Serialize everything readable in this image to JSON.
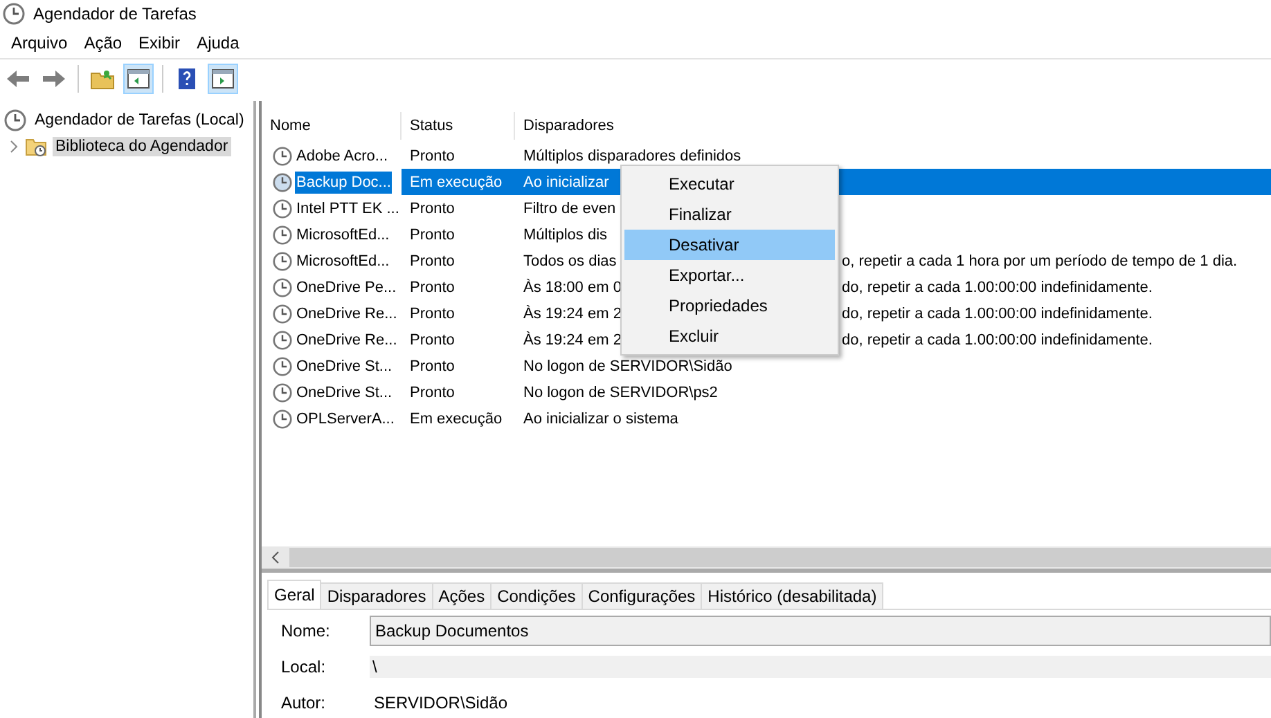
{
  "window": {
    "title": "Agendador de Tarefas"
  },
  "menu_bar": [
    "Arquivo",
    "Ação",
    "Exibir",
    "Ajuda"
  ],
  "toolbar": [
    {
      "kind": "back",
      "pressed": false
    },
    {
      "kind": "forward",
      "pressed": false
    },
    {
      "kind": "folder",
      "pressed": false
    },
    {
      "kind": "panel-left",
      "pressed": true
    },
    {
      "kind": "help",
      "pressed": false
    },
    {
      "kind": "panel-right",
      "pressed": true
    }
  ],
  "tree": [
    {
      "label": "Agendador de Tarefas (Local)",
      "selected": false,
      "children": [
        {
          "label": "Biblioteca do Agendador",
          "selected": true,
          "expanded": false
        }
      ]
    }
  ],
  "task_list": {
    "columns": [
      "Nome",
      "Status",
      "Disparadores"
    ],
    "rows": [
      {
        "name": "Adobe Acro...",
        "status": "Pronto",
        "trigger": "Múltiplos disparadores definidos",
        "selected": false
      },
      {
        "name": "Backup Doc...",
        "status": "Em execução",
        "trigger": "Ao inicializar",
        "selected": true
      },
      {
        "name": "Intel PTT EK ...",
        "status": "Pronto",
        "trigger": "Filtro de even",
        "selected": false
      },
      {
        "name": "MicrosoftEd...",
        "status": "Pronto",
        "trigger": "Múltiplos dis",
        "selected": false
      },
      {
        "name": "MicrosoftEd...",
        "status": "Pronto",
        "trigger": "Todos os dias",
        "trigger_tail": "o, repetir a cada 1 hora por um período de tempo de 1 dia.",
        "selected": false
      },
      {
        "name": "OneDrive Pe...",
        "status": "Pronto",
        "trigger": "Às 18:00 em 0",
        "trigger_tail": "do, repetir a cada 1.00:00:00 indefinidamente.",
        "selected": false
      },
      {
        "name": "OneDrive Re...",
        "status": "Pronto",
        "trigger": "Às 19:24 em 2",
        "trigger_tail": "do, repetir a cada 1.00:00:00 indefinidamente.",
        "selected": false
      },
      {
        "name": "OneDrive Re...",
        "status": "Pronto",
        "trigger": "Às 19:24 em 2",
        "trigger_tail": "do, repetir a cada 1.00:00:00 indefinidamente.",
        "selected": false
      },
      {
        "name": "OneDrive St...",
        "status": "Pronto",
        "trigger": "No logon de SERVIDOR\\Sidão",
        "selected": false
      },
      {
        "name": "OneDrive St...",
        "status": "Pronto",
        "trigger": "No logon de SERVIDOR\\ps2",
        "selected": false
      },
      {
        "name": "OPLServerA...",
        "status": "Em execução",
        "trigger": "Ao inicializar o sistema",
        "selected": false
      }
    ]
  },
  "context_menu": {
    "items": [
      {
        "label": "Executar",
        "selected": false
      },
      {
        "label": "Finalizar",
        "selected": false
      },
      {
        "label": "Desativar",
        "selected": true
      },
      {
        "label": "Exportar...",
        "selected": false
      },
      {
        "label": "Propriedades",
        "selected": false
      },
      {
        "label": "Excluir",
        "selected": false
      }
    ]
  },
  "details": {
    "tabs": [
      {
        "label": "Geral",
        "selected": true
      },
      {
        "label": "Disparadores",
        "selected": false
      },
      {
        "label": "Ações",
        "selected": false
      },
      {
        "label": "Condições",
        "selected": false
      },
      {
        "label": "Configurações",
        "selected": false
      },
      {
        "label": "Histórico (desabilitada)",
        "selected": false
      }
    ],
    "fields": [
      {
        "label": "Nome:",
        "value": "Backup Documentos",
        "kind": "input"
      },
      {
        "label": "Local:",
        "value": "\\",
        "kind": "readonly"
      },
      {
        "label": "Autor:",
        "value": "SERVIDOR\\Sidão",
        "kind": "plain"
      }
    ]
  }
}
